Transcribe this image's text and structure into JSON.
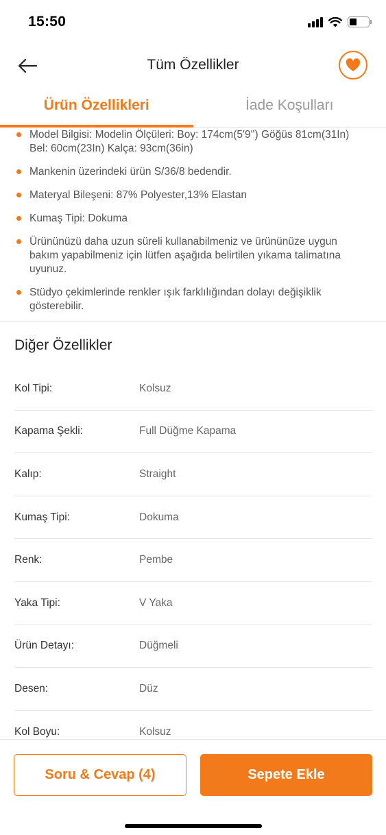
{
  "status": {
    "time": "15:50"
  },
  "header": {
    "title": "Tüm Özellikler"
  },
  "tabs": [
    {
      "label": "Ürün Özellikleri",
      "active": true
    },
    {
      "label": "İade Koşulları",
      "active": false
    }
  ],
  "bullets": [
    "Model Bilgisi: Modelin Ölçüleri: Boy: 174cm(5'9'') Göğüs 81cm(31In) Bel: 60cm(23In) Kalça: 93cm(36in)",
    "Mankenin üzerindeki ürün S/36/8 bedendir.",
    "Materyal Bileşeni: 87% Polyester,13% Elastan",
    "Kumaş Tipi: Dokuma",
    "Ürününüzü daha uzun süreli kullanabilmeniz ve ürününüze uygun bakım yapabilmeniz için lütfen aşağıda belirtilen yıkama talimatına uyunuz.",
    "Stüdyo çekimlerinde renkler ışık farklılığından dolayı değişiklik gösterebilir."
  ],
  "other": {
    "title": "Diğer Özellikler",
    "rows": [
      {
        "key": "Kol Tipi:",
        "value": "Kolsuz"
      },
      {
        "key": "Kapama Şekli:",
        "value": "Full Düğme Kapama"
      },
      {
        "key": "Kalıp:",
        "value": "Straight"
      },
      {
        "key": "Kumaş Tipi:",
        "value": "Dokuma"
      },
      {
        "key": "Renk:",
        "value": "Pembe"
      },
      {
        "key": "Yaka Tipi:",
        "value": "V Yaka"
      },
      {
        "key": "Ürün Detayı:",
        "value": "Düğmeli"
      },
      {
        "key": "Desen:",
        "value": "Düz"
      },
      {
        "key": "Kol Boyu:",
        "value": "Kolsuz"
      }
    ]
  },
  "bottom": {
    "qa_label": "Soru & Cevap (4)",
    "cart_label": "Sepete Ekle"
  },
  "icons": {
    "back": "arrow-left-icon",
    "favorite": "heart-icon"
  },
  "colors": {
    "accent": "#f27a1a"
  }
}
